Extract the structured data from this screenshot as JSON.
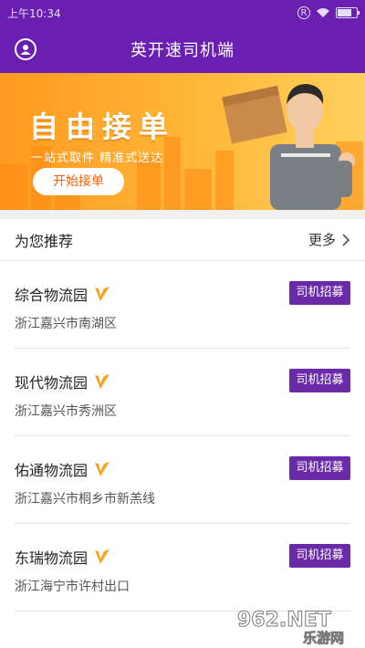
{
  "status_bar": {
    "time": "上午10:34",
    "battery_level": 0.85
  },
  "header": {
    "title": "英开速司机端"
  },
  "banner": {
    "title": "自由接单",
    "subtitle": "一站式取件 精准式送达",
    "button_label": "开始接单"
  },
  "recommend": {
    "title": "为您推荐",
    "more_label": "更多"
  },
  "items": [
    {
      "name": "综合物流园",
      "address": "浙江嘉兴市南湖区",
      "button": "司机招募"
    },
    {
      "name": "现代物流园",
      "address": "浙江嘉兴市秀洲区",
      "button": "司机招募"
    },
    {
      "name": "佑通物流园",
      "address": "浙江嘉兴市桐乡市新羔线",
      "button": "司机招募"
    },
    {
      "name": "东瑞物流园",
      "address": "浙江海宁市许村出口",
      "button": "司机招募"
    }
  ],
  "watermark": {
    "brand": "962.NET",
    "sub": "乐游网"
  },
  "colors": {
    "primary": "#6a1fb0",
    "button": "#6a2aa8",
    "banner_orange": "#ff9a1f",
    "verified": "#f5a623"
  }
}
